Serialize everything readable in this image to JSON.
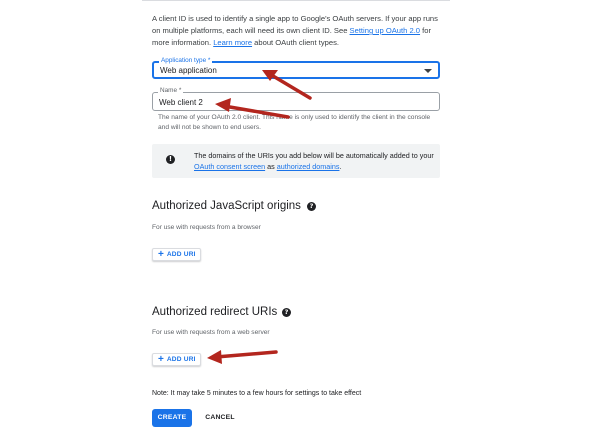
{
  "intro": {
    "text_before_link1": "A client ID is used to identify a single app to Google's OAuth servers. If your app runs on multiple platforms, each will need its own client ID. See ",
    "link1": "Setting up OAuth 2.0",
    "text_middle": " for more information. ",
    "link2": "Learn more",
    "text_after": " about OAuth client types."
  },
  "application_type": {
    "label": "Application type *",
    "value": "Web application"
  },
  "name_field": {
    "label": "Name *",
    "value": "Web client 2",
    "helper": "The name of your OAuth 2.0 client. This name is only used to identify the client in the console and will not be shown to end users."
  },
  "info": {
    "icon": "!",
    "text_before": "The domains of the URIs you add below will be automatically added to your ",
    "link1": "OAuth consent screen",
    "text_middle": " as ",
    "link2": "authorized domains",
    "text_after": "."
  },
  "js_origins": {
    "title": "Authorized JavaScript origins",
    "help": "?",
    "subtitle": "For use with requests from a browser",
    "add_label": "ADD URI"
  },
  "redirect_uris": {
    "title": "Authorized redirect URIs",
    "help": "?",
    "subtitle": "For use with requests from a web server",
    "add_label": "ADD URI"
  },
  "note": "Note: It may take 5 minutes to a few hours for settings to take effect",
  "actions": {
    "create": "CREATE",
    "cancel": "CANCEL"
  },
  "colors": {
    "accent": "#1a73e8",
    "annotation_arrow": "#b3261e"
  }
}
